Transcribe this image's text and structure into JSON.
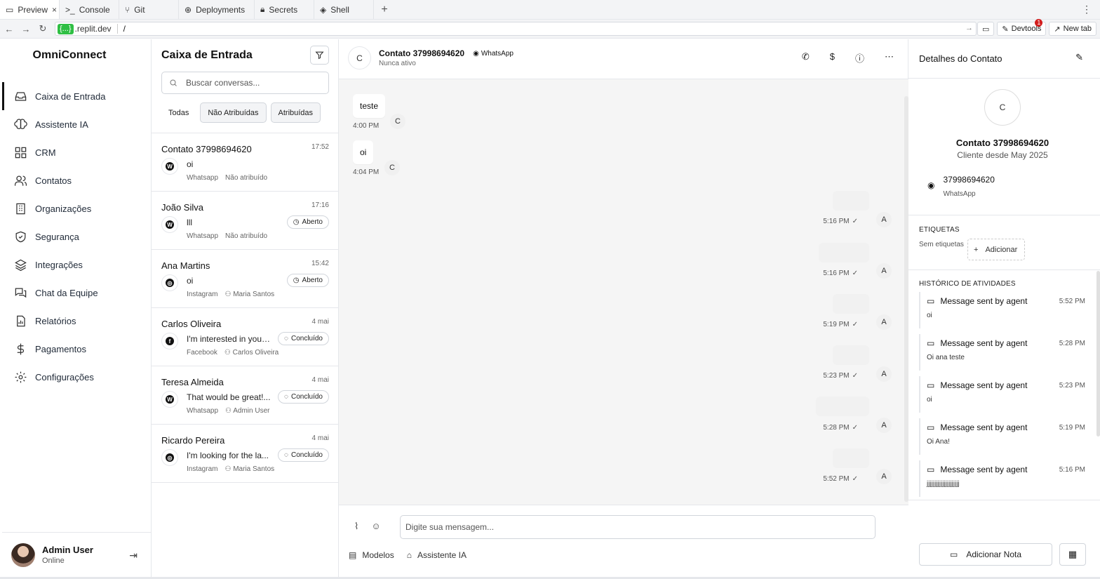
{
  "browser": {
    "tabs": [
      {
        "label": "Preview",
        "icon": "preview-icon",
        "active": true
      },
      {
        "label": "Console",
        "icon": "console-icon"
      },
      {
        "label": "Git",
        "icon": "git-icon"
      },
      {
        "label": "Deployments",
        "icon": "deploy-icon"
      },
      {
        "label": "Secrets",
        "icon": "lock-icon"
      },
      {
        "label": "Shell",
        "icon": "shell-icon"
      }
    ],
    "url_chip": "{...}",
    "url_host": ".replit.dev",
    "url_path": "/",
    "devtools_label": "Devtools",
    "devtools_badge": "1",
    "newtab_label": "New tab"
  },
  "sidebar": {
    "brand": "OmniConnect",
    "items": [
      {
        "label": "Caixa de Entrada",
        "icon": "inbox-icon",
        "active": true
      },
      {
        "label": "Assistente IA",
        "icon": "brain-icon"
      },
      {
        "label": "CRM",
        "icon": "grid-icon"
      },
      {
        "label": "Contatos",
        "icon": "users-icon"
      },
      {
        "label": "Organizações",
        "icon": "building-icon"
      },
      {
        "label": "Segurança",
        "icon": "shield-icon"
      },
      {
        "label": "Integrações",
        "icon": "layers-icon"
      },
      {
        "label": "Chat da Equipe",
        "icon": "chat-icon"
      },
      {
        "label": "Relatórios",
        "icon": "report-icon"
      },
      {
        "label": "Pagamentos",
        "icon": "dollar-icon"
      },
      {
        "label": "Configurações",
        "icon": "gear-icon"
      }
    ],
    "user": {
      "name": "Admin User",
      "status": "Online"
    }
  },
  "inbox": {
    "title": "Caixa de Entrada",
    "search_placeholder": "Buscar conversas...",
    "filters": [
      "Todas",
      "Não Atribuídas",
      "Atribuídas"
    ],
    "conversations": [
      {
        "name": "Contato 37998694620",
        "time": "17:52",
        "message": "oi",
        "channel": "Whatsapp",
        "assignee": "Não atribuído",
        "status": "",
        "channel_glyph": "W"
      },
      {
        "name": "João Silva",
        "time": "17:16",
        "message": "lll",
        "channel": "Whatsapp",
        "assignee": "Não atribuído",
        "status": "Aberto",
        "channel_glyph": "W"
      },
      {
        "name": "Ana Martins",
        "time": "15:42",
        "message": "oi",
        "channel": "Instagram",
        "assignee": "Maria Santos",
        "status": "Aberto",
        "channel_glyph": "◎"
      },
      {
        "name": "Carlos Oliveira",
        "time": "4 mai",
        "message": "I'm interested in your...",
        "channel": "Facebook",
        "assignee": "Carlos Oliveira",
        "status": "Concluído",
        "channel_glyph": "f"
      },
      {
        "name": "Teresa Almeida",
        "time": "4 mai",
        "message": "That would be great!...",
        "channel": "Whatsapp",
        "assignee": "Admin User",
        "status": "Concluído",
        "channel_glyph": "W"
      },
      {
        "name": "Ricardo Pereira",
        "time": "4 mai",
        "message": "I'm looking for the la...",
        "channel": "Instagram",
        "assignee": "Maria Santos",
        "status": "Concluído",
        "channel_glyph": "◎"
      }
    ]
  },
  "chat": {
    "avatar": "C",
    "title": "Contato 37998694620",
    "channel": "WhatsApp",
    "subtitle": "Nunca ativo",
    "incoming": [
      {
        "text": "teste",
        "time": "4:00 PM",
        "avatar": "C"
      },
      {
        "text": "oi",
        "time": "4:04 PM",
        "avatar": "C"
      }
    ],
    "outgoing": [
      {
        "time": "5:16 PM",
        "avatar": "A"
      },
      {
        "time": "5:16 PM",
        "avatar": "A"
      },
      {
        "time": "5:19 PM",
        "avatar": "A"
      },
      {
        "time": "5:23 PM",
        "avatar": "A"
      },
      {
        "time": "5:28 PM",
        "avatar": "A"
      },
      {
        "time": "5:52 PM",
        "avatar": "A"
      }
    ],
    "input_placeholder": "Digite sua mensagem...",
    "templates_label": "Modelos",
    "assistant_label": "Assistente IA"
  },
  "details": {
    "title": "Detalhes do Contato",
    "avatar": "C",
    "name": "Contato 37998694620",
    "since": "Cliente desde May 2025",
    "phone": "37998694620",
    "phone_channel": "WhatsApp",
    "tags_title": "ETIQUETAS",
    "no_tags": "Sem etiquetas",
    "add_tag": "Adicionar",
    "history_title": "HISTÓRICO DE ATIVIDADES",
    "activities": [
      {
        "title": "Message sent by agent",
        "time": "5:52 PM",
        "desc": "oi"
      },
      {
        "title": "Message sent by agent",
        "time": "5:28 PM",
        "desc": "Oi ana teste"
      },
      {
        "title": "Message sent by agent",
        "time": "5:23 PM",
        "desc": "oi"
      },
      {
        "title": "Message sent by agent",
        "time": "5:19 PM",
        "desc": "Oi Ana!"
      },
      {
        "title": "Message sent by agent",
        "time": "5:16 PM",
        "desc": "jjjjjjjjjjjjjjjjjjjjj"
      }
    ],
    "add_note": "Adicionar Nota"
  }
}
